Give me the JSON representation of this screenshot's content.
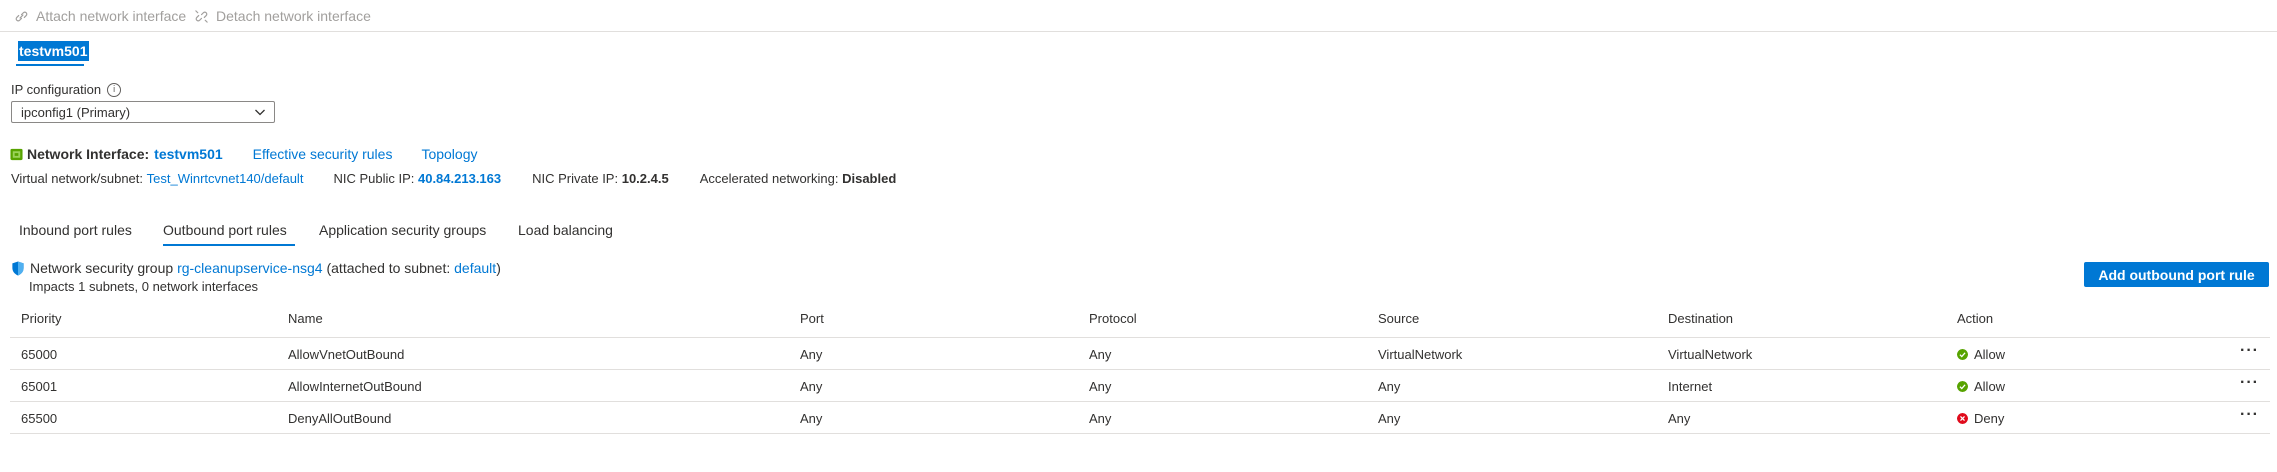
{
  "toolbar": {
    "attach_label": "Attach network interface",
    "detach_label": "Detach network interface"
  },
  "nic_tab": {
    "label": "testvm501"
  },
  "ip_config": {
    "label": "IP configuration",
    "selected": "ipconfig1 (Primary)"
  },
  "network_interface": {
    "label": "Network Interface:",
    "name": "testvm501",
    "effective_rules_link": "Effective security rules",
    "topology_link": "Topology"
  },
  "details": {
    "vnet_label": "Virtual network/subnet:",
    "vnet_value": "Test_Winrtcvnet140/default",
    "public_ip_label": "NIC Public IP:",
    "public_ip_value": "40.84.213.163",
    "private_ip_label": "NIC Private IP:",
    "private_ip_value": "10.2.4.5",
    "accel_label": "Accelerated networking:",
    "accel_value": "Disabled"
  },
  "tabs": [
    {
      "label": "Inbound port rules"
    },
    {
      "label": "Outbound port rules"
    },
    {
      "label": "Application security groups"
    },
    {
      "label": "Load balancing"
    }
  ],
  "nsg": {
    "prefix": "Network security group",
    "name": "rg-cleanupservice-nsg4",
    "attached_prefix": "(attached to subnet:",
    "subnet": "default",
    "attached_suffix": ")",
    "impacts": "Impacts 1 subnets, 0 network interfaces"
  },
  "add_button": {
    "label": "Add outbound port rule"
  },
  "table": {
    "headers": {
      "priority": "Priority",
      "name": "Name",
      "port": "Port",
      "protocol": "Protocol",
      "source": "Source",
      "destination": "Destination",
      "action": "Action"
    },
    "rows": [
      {
        "priority": "65000",
        "name": "AllowVnetOutBound",
        "port": "Any",
        "protocol": "Any",
        "source": "VirtualNetwork",
        "destination": "VirtualNetwork",
        "action": "Allow"
      },
      {
        "priority": "65001",
        "name": "AllowInternetOutBound",
        "port": "Any",
        "protocol": "Any",
        "source": "Any",
        "destination": "Internet",
        "action": "Allow"
      },
      {
        "priority": "65500",
        "name": "DenyAllOutBound",
        "port": "Any",
        "protocol": "Any",
        "source": "Any",
        "destination": "Any",
        "action": "Deny"
      }
    ],
    "more_glyph": "···"
  },
  "colors": {
    "accent": "#0078d4",
    "allow": "#57a300",
    "deny": "#e00b1c",
    "disabled_text": "#a19f9d"
  },
  "icons": {
    "attach": "link-icon",
    "detach": "unlink-icon",
    "info": "info-icon",
    "nic": "network-interface-icon",
    "nsg": "shield-icon",
    "allow": "check-circle-icon",
    "deny": "error-circle-icon",
    "more": "more-icon"
  }
}
